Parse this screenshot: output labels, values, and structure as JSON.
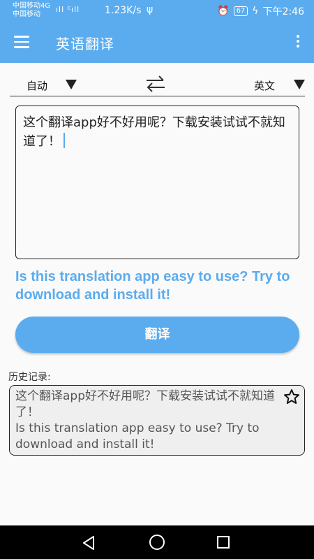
{
  "status_bar": {
    "carrier1": "中国移动4G",
    "carrier2": "中国移动",
    "net": "ıll ᴱıll",
    "speed": "1.23K/s",
    "battery": "67",
    "time": "下午2:46"
  },
  "app_bar": {
    "title": "英语翻译"
  },
  "lang": {
    "source": "自动",
    "target": "英文"
  },
  "input": {
    "value": "这个翻译app好不好用呢？下载安装试试不就知道了！"
  },
  "result": {
    "text": "Is this translation app easy to use? Try to download and install it!"
  },
  "translate_button": {
    "label": "翻译"
  },
  "history": {
    "label": "历史记录:",
    "items": [
      {
        "source": "这个翻译app好不好用呢？下载安装试试不就知道了！",
        "target": "Is this translation app easy to use? Try to download and install it!"
      }
    ]
  },
  "colors": {
    "accent": "#5aacef",
    "nav_bar": "#000000"
  }
}
